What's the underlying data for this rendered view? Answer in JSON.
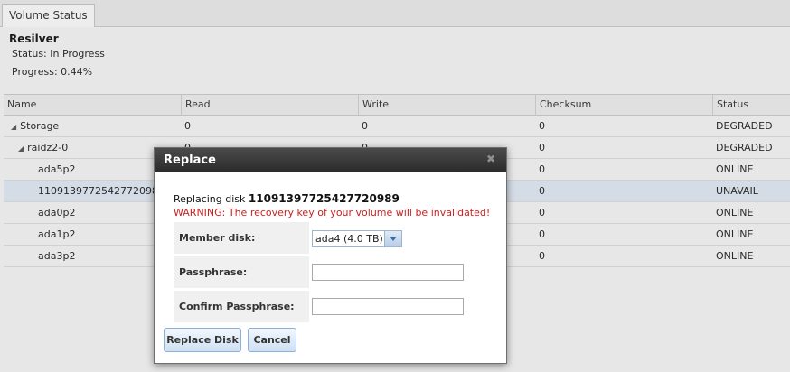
{
  "tabs": [
    {
      "label": "Volume Status"
    }
  ],
  "resilver": {
    "heading": "Resilver",
    "status": "Status: In Progress",
    "progress": "Progress: 0.44%"
  },
  "table": {
    "columns": [
      "Name",
      "Read",
      "Write",
      "Checksum",
      "Status"
    ],
    "rows": [
      {
        "name": "Storage",
        "read": "0",
        "write": "0",
        "checksum": "0",
        "status": "DEGRADED"
      },
      {
        "name": "raidz2-0",
        "read": "0",
        "write": "0",
        "checksum": "0",
        "status": "DEGRADED"
      },
      {
        "name": "ada5p2",
        "read": "",
        "write": "",
        "checksum": "0",
        "status": "ONLINE"
      },
      {
        "name": "11091397725427720989",
        "read": "",
        "write": "",
        "checksum": "0",
        "status": "UNAVAIL"
      },
      {
        "name": "ada0p2",
        "read": "",
        "write": "",
        "checksum": "0",
        "status": "ONLINE"
      },
      {
        "name": "ada1p2",
        "read": "",
        "write": "",
        "checksum": "0",
        "status": "ONLINE"
      },
      {
        "name": "ada3p2",
        "read": "",
        "write": "",
        "checksum": "0",
        "status": "ONLINE"
      }
    ]
  },
  "dialog": {
    "title": "Replace",
    "close_icon": "close-icon",
    "replacing_prefix": "Replacing disk ",
    "replacing_disk": "11091397725427720989",
    "warning": "WARNING: The recovery key of your volume will be invalidated!",
    "member_disk_label": "Member disk:",
    "member_disk_value": "ada4 (4.0 TB)",
    "passphrase_label": "Passphrase:",
    "passphrase_value": "",
    "confirm_label": "Confirm Passphrase:",
    "confirm_value": "",
    "replace_button": "Replace Disk",
    "cancel_button": "Cancel"
  },
  "colors": {
    "dialog_title_bg": "#2f2f2f",
    "warning": "#cc1f1f",
    "selected_row": "#dfe8f3"
  }
}
